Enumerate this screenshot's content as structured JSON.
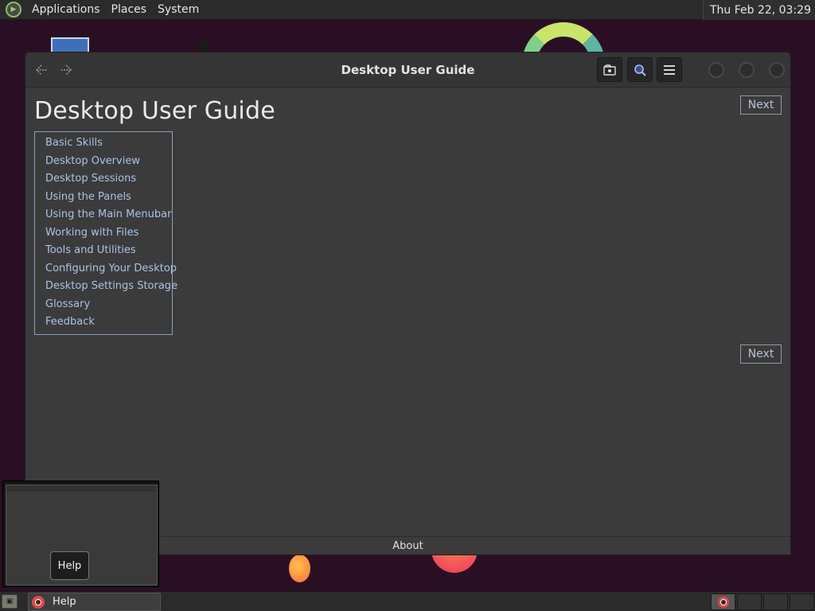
{
  "top_panel": {
    "menus": [
      "Applications",
      "Places",
      "System"
    ],
    "clock": "Thu Feb 22, 03:29"
  },
  "window": {
    "title": "Desktop User Guide",
    "nav": {
      "back_icon": "arrow-left-icon",
      "forward_icon": "arrow-right-icon"
    },
    "toolbar": [
      "bookmark-icon",
      "search-icon",
      "menu-icon"
    ]
  },
  "content": {
    "heading": "Desktop User Guide",
    "next_label": "Next",
    "toc": [
      "Basic Skills",
      "Desktop Overview",
      "Desktop Sessions",
      "Using the Panels",
      "Using the Main Menubar",
      "Working with Files",
      "Tools and Utilities",
      "Configuring Your Desktop",
      "Desktop Settings Storage",
      "Glossary",
      "Feedback"
    ],
    "footer": "About"
  },
  "preview": {
    "tooltip": "Help"
  },
  "taskbar": {
    "task_label": "Help"
  },
  "colors": {
    "desktop_bg": "#2a0f24",
    "window_bg": "#3b3b3b",
    "link": "#a9c3e6"
  }
}
